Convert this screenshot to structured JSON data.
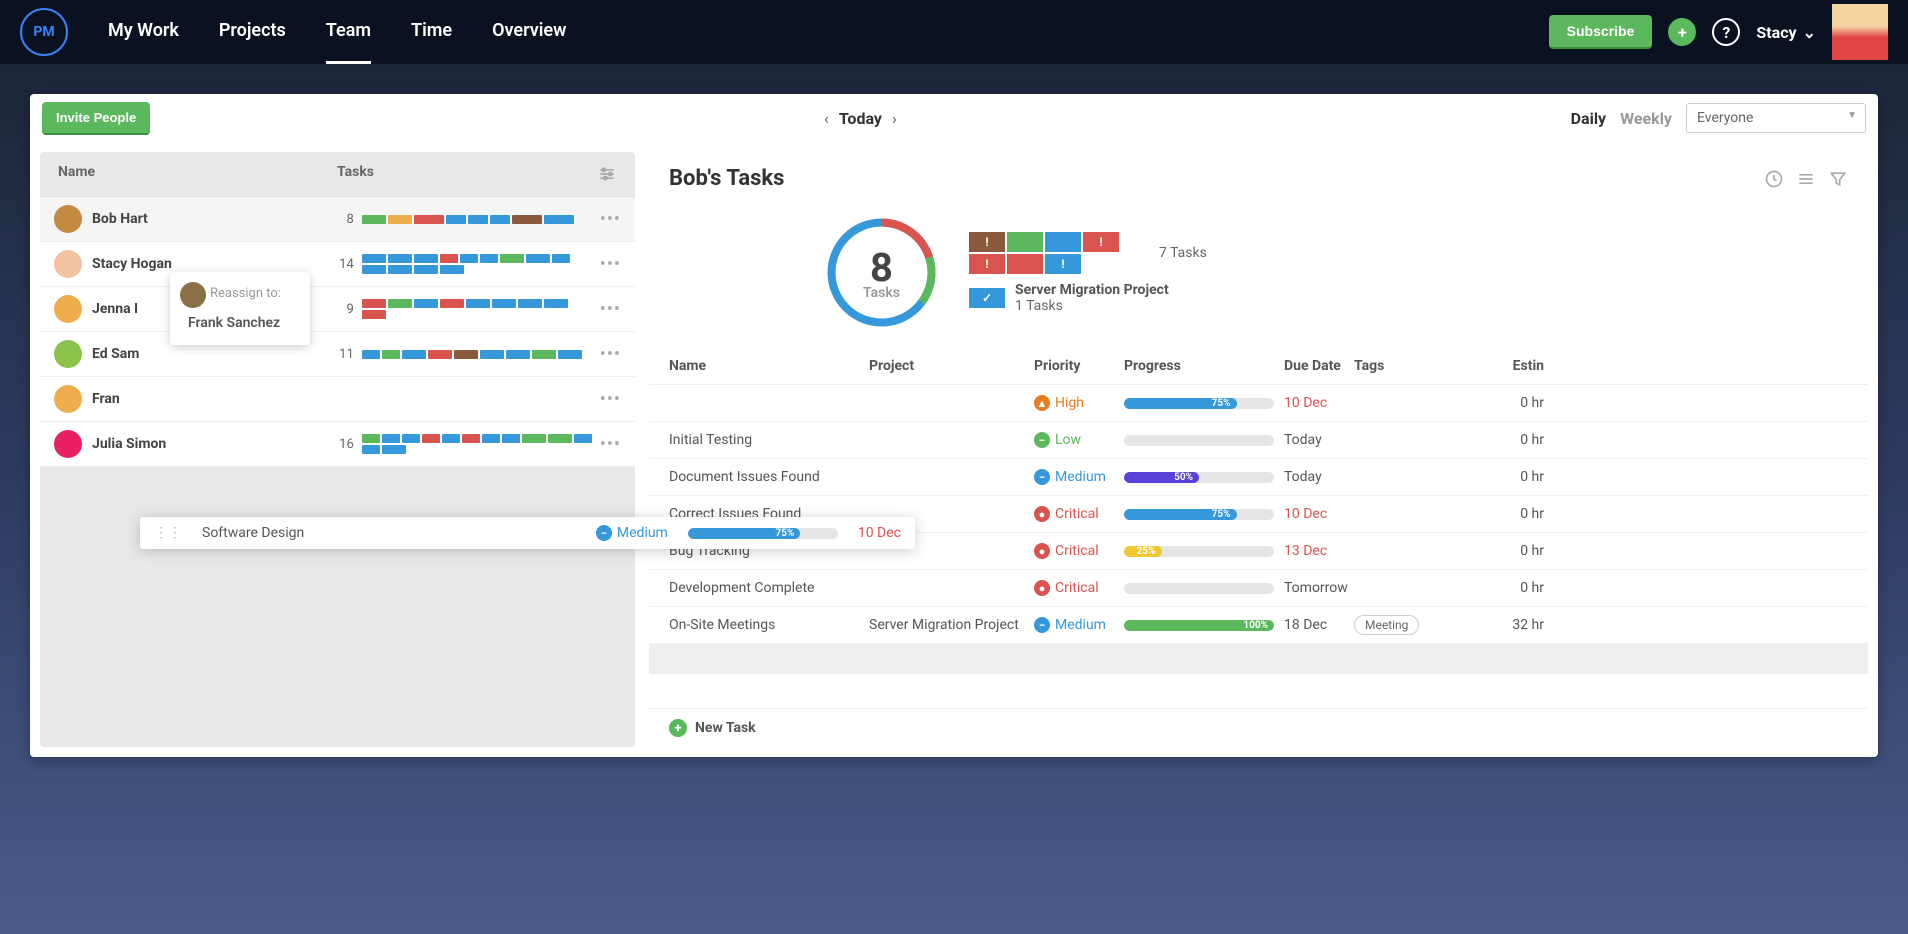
{
  "nav": {
    "items": [
      "My Work",
      "Projects",
      "Team",
      "Time",
      "Overview"
    ],
    "active": 2
  },
  "topbar": {
    "subscribe": "Subscribe",
    "user": "Stacy"
  },
  "toolbar": {
    "invite": "Invite People",
    "today": "Today",
    "daily": "Daily",
    "weekly": "Weekly",
    "filter_select": "Everyone"
  },
  "left": {
    "headers": {
      "name": "Name",
      "tasks": "Tasks"
    },
    "people": [
      {
        "name": "Bob Hart",
        "count": 8,
        "avatar": "#c48a3f",
        "bars": [
          [
            24,
            "#5cb85c"
          ],
          [
            24,
            "#f0ad4e"
          ],
          [
            30,
            "#d9534f"
          ],
          [
            20,
            "#3498db"
          ],
          [
            20,
            "#3498db"
          ],
          [
            20,
            "#3498db"
          ],
          [
            30,
            "#8b5a3c"
          ],
          [
            30,
            "#3498db"
          ]
        ]
      },
      {
        "name": "Stacy Hogan",
        "count": 14,
        "avatar": "#f4c2a1",
        "bars": [
          [
            24,
            "#3498db"
          ],
          [
            24,
            "#3498db"
          ],
          [
            24,
            "#3498db"
          ],
          [
            18,
            "#d9534f"
          ],
          [
            18,
            "#3498db"
          ],
          [
            18,
            "#3498db"
          ],
          [
            24,
            "#5cb85c"
          ],
          [
            24,
            "#3498db"
          ],
          [
            18,
            "#3498db"
          ],
          [
            24,
            "#3498db"
          ],
          [
            24,
            "#3498db"
          ],
          [
            24,
            "#3498db"
          ],
          [
            24,
            "#3498db"
          ]
        ]
      },
      {
        "name": "Jenna I",
        "count": 9,
        "avatar": "#f0ad4e",
        "bars": [
          [
            24,
            "#d9534f"
          ],
          [
            24,
            "#5cb85c"
          ],
          [
            24,
            "#3498db"
          ],
          [
            24,
            "#d9534f"
          ],
          [
            24,
            "#3498db"
          ],
          [
            24,
            "#3498db"
          ],
          [
            24,
            "#3498db"
          ],
          [
            24,
            "#3498db"
          ],
          [
            24,
            "#d9534f"
          ]
        ]
      },
      {
        "name": "Ed Sam",
        "count": 11,
        "avatar": "#8bc34a",
        "bars": [
          [
            18,
            "#3498db"
          ],
          [
            18,
            "#5cb85c"
          ],
          [
            24,
            "#3498db"
          ],
          [
            24,
            "#d9534f"
          ],
          [
            24,
            "#8b5a3c"
          ],
          [
            24,
            "#3498db"
          ],
          [
            24,
            "#3498db"
          ],
          [
            24,
            "#5cb85c"
          ],
          [
            24,
            "#3498db"
          ]
        ]
      },
      {
        "name": "Fran",
        "count": "",
        "avatar": "#f0ad4e",
        "bars": []
      },
      {
        "name": "Julia Simon",
        "count": 16,
        "avatar": "#e91e63",
        "bars": [
          [
            18,
            "#5cb85c"
          ],
          [
            18,
            "#3498db"
          ],
          [
            18,
            "#3498db"
          ],
          [
            18,
            "#d9534f"
          ],
          [
            18,
            "#3498db"
          ],
          [
            18,
            "#d9534f"
          ],
          [
            18,
            "#3498db"
          ],
          [
            18,
            "#3498db"
          ],
          [
            24,
            "#5cb85c"
          ],
          [
            24,
            "#5cb85c"
          ],
          [
            18,
            "#3498db"
          ],
          [
            18,
            "#3498db"
          ],
          [
            24,
            "#3498db"
          ]
        ]
      }
    ],
    "reassign": {
      "label": "Reassign to:",
      "name": "Frank Sanchez"
    },
    "drag_task": {
      "title": "Software Design",
      "priority": "Medium",
      "progress": 75,
      "due": "10 Dec"
    }
  },
  "right": {
    "title": "Bob's Tasks",
    "donut": {
      "count": 8,
      "label": "Tasks",
      "segments": [
        [
          20,
          "#d9534f"
        ],
        [
          15,
          "#5cb85c"
        ],
        [
          65,
          "#3498db"
        ]
      ]
    },
    "groups": [
      {
        "blocks": [
          [
            "#8b5a3c",
            "!"
          ],
          [
            "#5cb85c",
            ""
          ],
          [
            "#3498db",
            ""
          ],
          [
            "#d9534f",
            "!"
          ],
          [
            "#d9534f",
            "!"
          ],
          [
            "#d9534f",
            ""
          ],
          [
            "#3498db",
            "!"
          ]
        ],
        "text": "7 Tasks"
      },
      {
        "blocks": [
          [
            "#3498db",
            "✓"
          ]
        ],
        "title": "Server Migration Project",
        "text": "1 Tasks"
      }
    ],
    "headers": {
      "name": "Name",
      "project": "Project",
      "priority": "Priority",
      "progress": "Progress",
      "due": "Due Date",
      "tags": "Tags",
      "est": "Estin"
    },
    "tasks": [
      {
        "name": "",
        "project": "",
        "priority": "High",
        "prio_color": "#e67e22",
        "prio_mark": "▲",
        "progress": 75,
        "prog_color": "#3498db",
        "due": "10 Dec",
        "due_color": "#d9534f",
        "tags": "",
        "est": "0 hr"
      },
      {
        "name": "Initial Testing",
        "project": "",
        "priority": "Low",
        "prio_color": "#5cb85c",
        "prio_mark": "−",
        "progress": 0,
        "prog_color": "#3498db",
        "due": "Today",
        "due_color": "#555",
        "tags": "",
        "est": "0 hr"
      },
      {
        "name": "Document Issues Found",
        "project": "",
        "priority": "Medium",
        "prio_color": "#3498db",
        "prio_mark": "−",
        "progress": 50,
        "prog_color": "#5b3fd9",
        "due": "Today",
        "due_color": "#555",
        "tags": "",
        "est": "0 hr"
      },
      {
        "name": "Correct Issues Found",
        "project": "",
        "priority": "Critical",
        "prio_color": "#d9534f",
        "prio_mark": "●",
        "progress": 75,
        "prog_color": "#3498db",
        "due": "10 Dec",
        "due_color": "#d9534f",
        "tags": "",
        "est": "0 hr"
      },
      {
        "name": "Bug Tracking",
        "project": "",
        "priority": "Critical",
        "prio_color": "#d9534f",
        "prio_mark": "●",
        "progress": 25,
        "prog_color": "#f0c930",
        "due": "13 Dec",
        "due_color": "#d9534f",
        "tags": "",
        "est": "0 hr"
      },
      {
        "name": "Development Complete",
        "project": "",
        "priority": "Critical",
        "prio_color": "#d9534f",
        "prio_mark": "●",
        "progress": 0,
        "prog_color": "#3498db",
        "due": "Tomorrow",
        "due_color": "#555",
        "tags": "",
        "est": "0 hr"
      },
      {
        "name": "On-Site Meetings",
        "project": "Server Migration Project",
        "priority": "Medium",
        "prio_color": "#3498db",
        "prio_mark": "−",
        "progress": 100,
        "prog_color": "#5cb85c",
        "due": "18 Dec",
        "due_color": "#555",
        "tags": "Meeting",
        "est": "32 hr"
      }
    ],
    "new_task": "New Task"
  }
}
